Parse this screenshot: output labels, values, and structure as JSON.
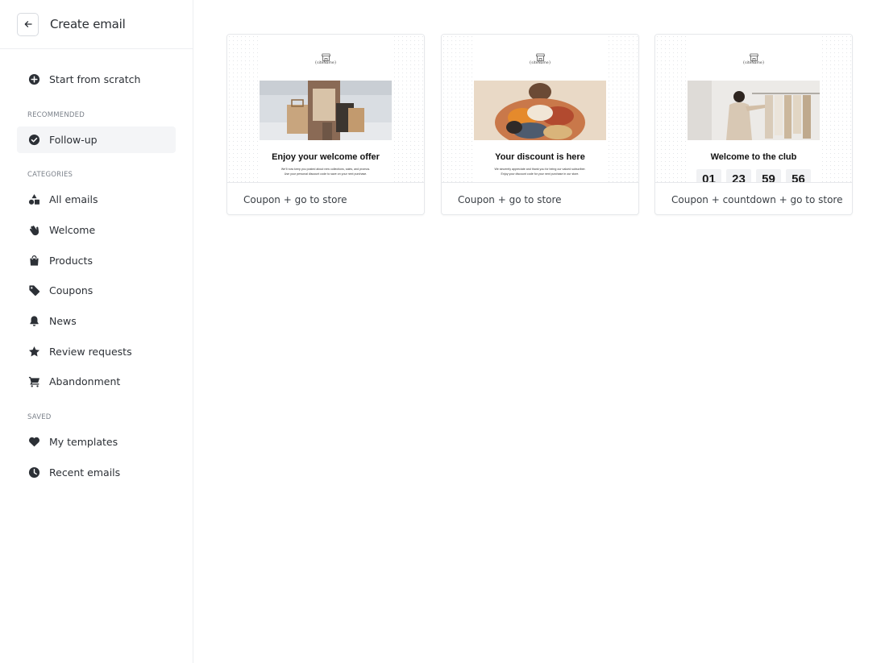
{
  "header": {
    "title": "Create email"
  },
  "sidebar": {
    "start_label": "Start from scratch",
    "recommended_label": "RECOMMENDED",
    "followup_label": "Follow-up",
    "categories_label": "CATEGORIES",
    "categories": [
      {
        "label": "All emails",
        "icon": "shapes-icon"
      },
      {
        "label": "Welcome",
        "icon": "wave-hand-icon"
      },
      {
        "label": "Products",
        "icon": "shopping-bag-icon"
      },
      {
        "label": "Coupons",
        "icon": "tag-icon"
      },
      {
        "label": "News",
        "icon": "bell-icon"
      },
      {
        "label": "Review requests",
        "icon": "star-icon"
      },
      {
        "label": "Abandonment",
        "icon": "cart-icon"
      }
    ],
    "saved_label": "SAVED",
    "saved": [
      {
        "label": "My templates",
        "icon": "heart-icon"
      },
      {
        "label": "Recent emails",
        "icon": "clock-icon"
      }
    ]
  },
  "templates": [
    {
      "name": "Coupon + go to store",
      "site": "{siteName}",
      "headline": "Enjoy your welcome offer",
      "body_line_1": "We'll now keep you posted about new collections, sales, and promos.",
      "body_line_2": "Use your personal discount code to save on your next purchase."
    },
    {
      "name": "Coupon + go to store",
      "site": "{siteName}",
      "headline": "Your discount is here",
      "body_line_1": "We sincerely appreciate and thank you for being our valued subscriber.",
      "body_line_2": "Enjoy your discount code for your next purchase in our store."
    },
    {
      "name": "Coupon + countdown + go to store",
      "site": "{siteName}",
      "headline": "Welcome to the club",
      "countdown": [
        "01",
        "23",
        "59",
        "56"
      ]
    }
  ]
}
